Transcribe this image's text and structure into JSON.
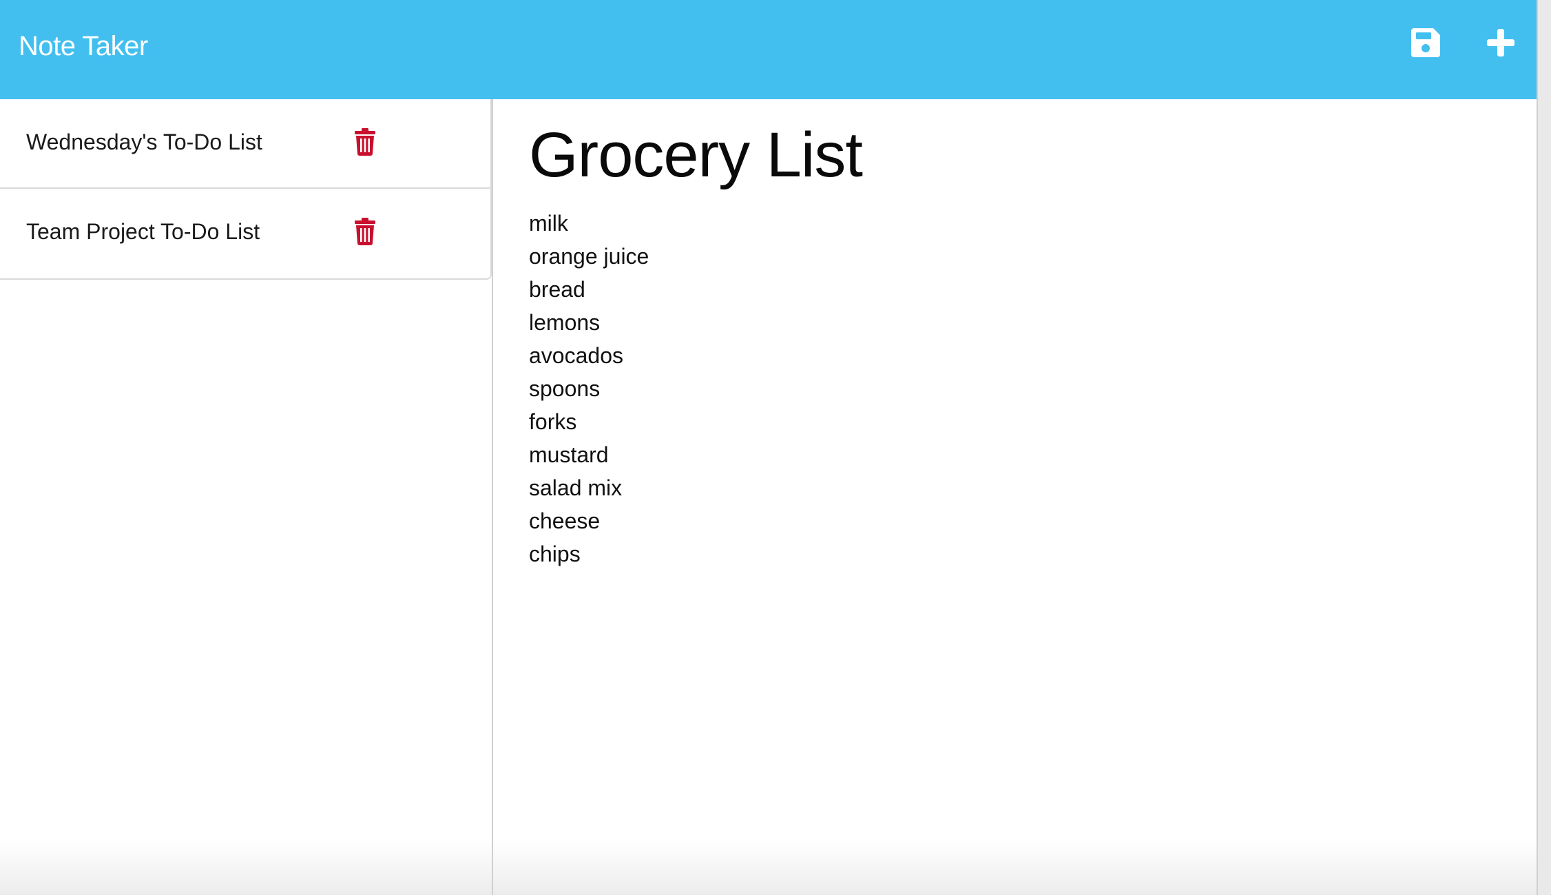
{
  "app": {
    "title": "Note Taker",
    "accent_color": "#43bfef",
    "delete_color": "#c8102e"
  },
  "header": {
    "icons": [
      {
        "name": "save-icon"
      },
      {
        "name": "plus-icon"
      }
    ]
  },
  "notes": [
    {
      "title": "Wednesday's To-Do List",
      "icon": "trash-icon"
    },
    {
      "title": "Team Project To-Do List",
      "icon": "trash-icon"
    }
  ],
  "active_note": {
    "title": "Grocery List",
    "text": "milk\norange juice\nbread\nlemons\navocados\nspoons\nforks\nmustard\nsalad mix\ncheese\nchips"
  }
}
